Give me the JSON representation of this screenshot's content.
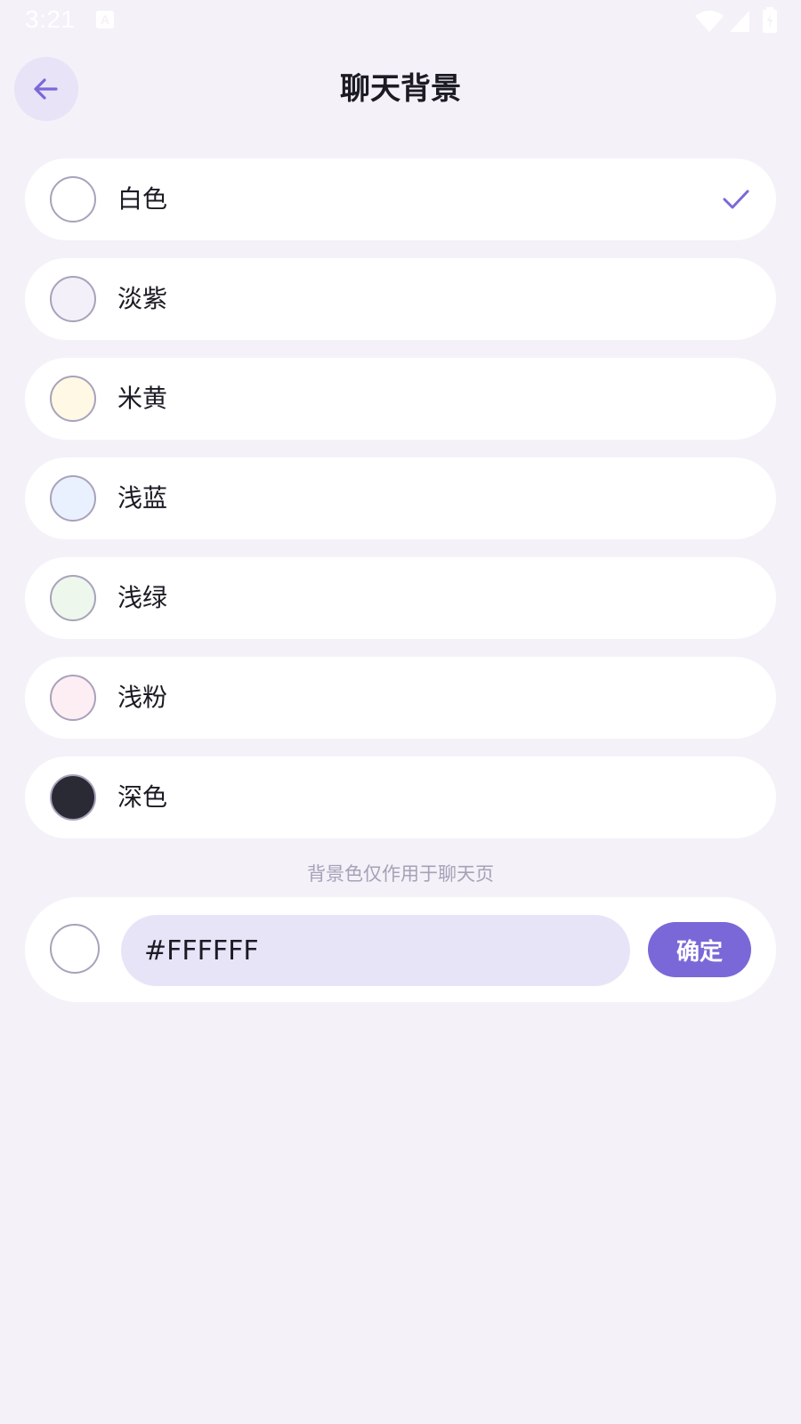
{
  "status_bar": {
    "time": "3:21",
    "notification_icon": "a-icon"
  },
  "header": {
    "back_icon": "arrow-left-icon",
    "title": "聊天背景"
  },
  "options": [
    {
      "label": "白色",
      "color": "#FFFFFF",
      "selected": true
    },
    {
      "label": "淡紫",
      "color": "#F3F0F9",
      "selected": false
    },
    {
      "label": "米黄",
      "color": "#FFF8E5",
      "selected": false
    },
    {
      "label": "浅蓝",
      "color": "#EAF1FE",
      "selected": false
    },
    {
      "label": "浅绿",
      "color": "#EDF7EC",
      "selected": false
    },
    {
      "label": "浅粉",
      "color": "#FDEEF3",
      "selected": false
    },
    {
      "label": "深色",
      "color": "#2A2A35",
      "selected": false
    }
  ],
  "hint": "背景色仅作用于聊天页",
  "custom": {
    "hex_value": "#FFFFFF",
    "confirm_label": "确定"
  },
  "colors": {
    "accent": "#7B68D8",
    "background": "#F4F1F9"
  }
}
